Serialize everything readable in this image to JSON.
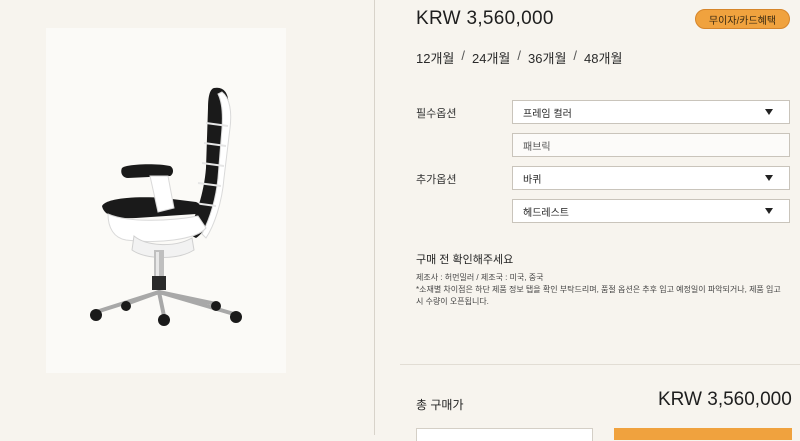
{
  "product": {
    "price": "KRW  3,560,000",
    "promo_button": "무이자/카드혜택",
    "installments": [
      "12개월",
      "24개월",
      "36개월",
      "48개월"
    ],
    "installment_separator": "/"
  },
  "options": {
    "required_label": "필수옵션",
    "additional_label": "추가옵션",
    "frame_color": "프레임 컬러",
    "fabric": "패브릭",
    "wheels": "바퀴",
    "headrest": "헤드레스트"
  },
  "notice": {
    "title": "구매 전 확인해주세요",
    "line1": "제조사 : 허먼밀러 / 제조국 : 미국, 중국",
    "line2": "*소재별 차이점은 하단 제품 정보 탭을 확인 부탁드리며, 품절 옵션은 추후 입고 예정일이 파악되거나, 제품 입고시 수량이 오픈됩니다."
  },
  "total": {
    "label": "총 구매가",
    "value": "KRW  3,560,000"
  },
  "colors": {
    "accent": "#f0a23e",
    "background": "#f7f4ee",
    "chair_frame": "#ffffff",
    "chair_mesh": "#1a1a1a"
  }
}
